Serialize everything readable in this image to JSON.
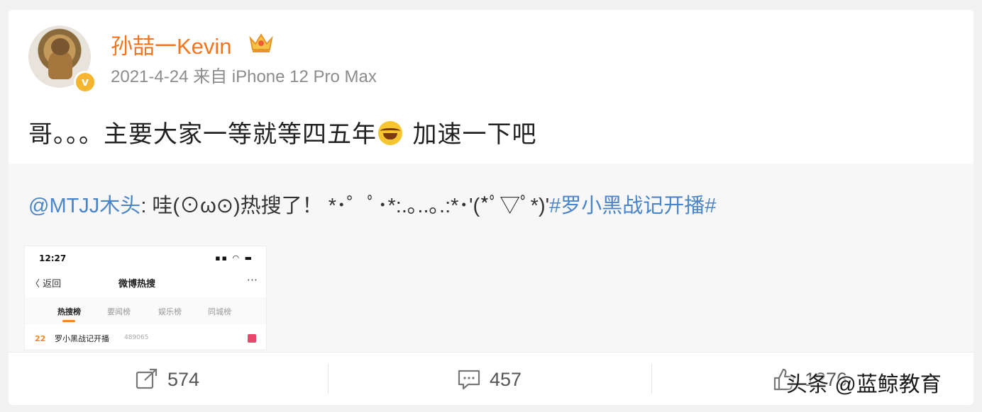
{
  "post": {
    "username": "孙喆一Kevin",
    "meta": "2021-4-24 来自 iPhone 12 Pro Max",
    "text_part1": "哥。。。主要大家一等就等四五年",
    "text_part2": " 加速一下吧",
    "emoji": "laughing-tears"
  },
  "repost": {
    "user": "@MTJJ木头",
    "text": ": 哇(⊙ω⊙)热搜了！ *･゜ﾟ･*:.｡..｡.:*･'(*ﾟ▽ﾟ*)'",
    "hashtag": "#罗小黑战记开播#"
  },
  "thumbnail": {
    "time": "12:27",
    "status_icons": "▪▪ ◠ ▬",
    "back_label": "〈 返回",
    "title": "微博热搜",
    "more": "···",
    "tabs": [
      "热搜榜",
      "要闻榜",
      "娱乐榜",
      "同城榜"
    ],
    "row_rank": "22",
    "row_title": "罗小黑战记开播",
    "row_count": "489065"
  },
  "actions": {
    "repost_count": "574",
    "comment_count": "457",
    "like_count": "1276"
  },
  "watermark": "头条 @蓝鲸教育",
  "colors": {
    "username": "#f5751f",
    "link": "#4a84c9",
    "verify": "#f5b52e"
  }
}
